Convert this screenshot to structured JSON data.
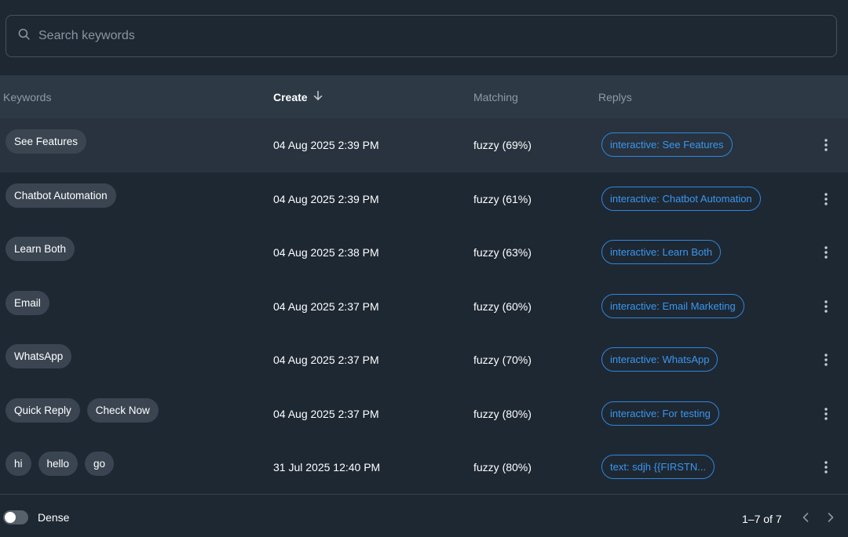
{
  "search": {
    "placeholder": "Search keywords"
  },
  "table": {
    "headers": {
      "keywords": "Keywords",
      "create": "Create",
      "matching": "Matching",
      "replies": "Replys"
    },
    "rows": [
      {
        "keywords": [
          "See Features"
        ],
        "created": "04 Aug 2025 2:39 PM",
        "matching": "fuzzy (69%)",
        "reply": "interactive: See Features"
      },
      {
        "keywords": [
          "Chatbot Automation"
        ],
        "created": "04 Aug 2025 2:39 PM",
        "matching": "fuzzy (61%)",
        "reply": "interactive: Chatbot Automation"
      },
      {
        "keywords": [
          "Learn Both"
        ],
        "created": "04 Aug 2025 2:38 PM",
        "matching": "fuzzy (63%)",
        "reply": "interactive: Learn Both"
      },
      {
        "keywords": [
          "Email"
        ],
        "created": "04 Aug 2025 2:37 PM",
        "matching": "fuzzy (60%)",
        "reply": "interactive: Email Marketing"
      },
      {
        "keywords": [
          "WhatsApp"
        ],
        "created": "04 Aug 2025 2:37 PM",
        "matching": "fuzzy (70%)",
        "reply": "interactive: WhatsApp"
      },
      {
        "keywords": [
          "Quick Reply",
          "Check Now"
        ],
        "created": "04 Aug 2025 2:37 PM",
        "matching": "fuzzy (80%)",
        "reply": "interactive: For testing"
      },
      {
        "keywords": [
          "hi",
          "hello",
          "go"
        ],
        "created": "31 Jul 2025 12:40 PM",
        "matching": "fuzzy (80%)",
        "reply": "text: sdjh {{FIRSTN..."
      }
    ]
  },
  "footer": {
    "dense_label": "Dense",
    "dense_enabled": false,
    "page_info": "1–7 of 7"
  },
  "colors": {
    "background": "#1e2833",
    "header": "#2d3945",
    "accent": "#2f86db"
  },
  "icons": {
    "search": "search-icon",
    "sort": "arrow-down-icon",
    "more": "more-vertical-icon",
    "prev": "chevron-left-icon",
    "next": "chevron-right-icon"
  }
}
